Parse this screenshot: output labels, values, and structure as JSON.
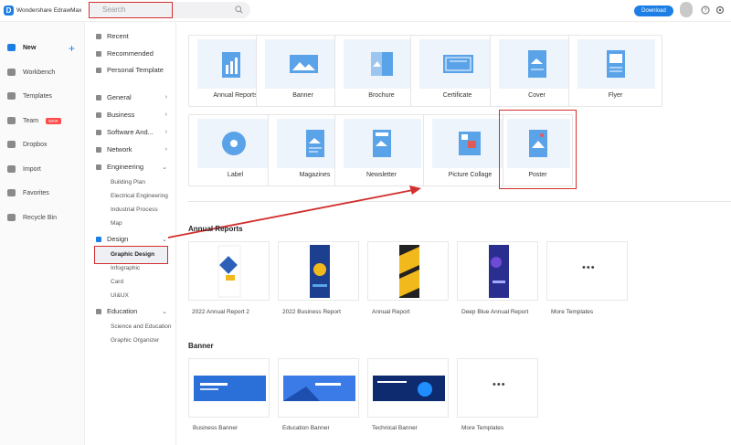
{
  "app": {
    "name": "Wondershare EdrawMax"
  },
  "search": {
    "placeholder": "Search"
  },
  "header": {
    "download_label": "Download"
  },
  "nav": {
    "items": [
      {
        "label": "New",
        "active": true
      },
      {
        "label": "Workbench"
      },
      {
        "label": "Templates"
      },
      {
        "label": "Team",
        "badge": "NEW"
      },
      {
        "label": "Dropbox"
      },
      {
        "label": "Import"
      },
      {
        "label": "Favorites"
      },
      {
        "label": "Recycle Bin"
      }
    ]
  },
  "categories": {
    "top": [
      "Recent",
      "Recommended",
      "Personal Template"
    ],
    "groups": [
      "General",
      "Business",
      "Software And...",
      "Network",
      "Engineering"
    ],
    "engineering_sub": [
      "Building Plan",
      "Electrical Engineering",
      "Industrial Process",
      "Map"
    ],
    "design": "Design",
    "design_sub": [
      "Graphic Design",
      "Infographic",
      "Card",
      "UI&UX"
    ],
    "education": "Education",
    "education_sub": [
      "Science and Education",
      "Graphic Organizer"
    ]
  },
  "template_types": [
    "Annual Reports",
    "Banner",
    "Brochure",
    "Certificate",
    "Cover",
    "Flyer",
    "Label",
    "Magazines",
    "Newsletter",
    "Picture Collage",
    "Poster"
  ],
  "sections": {
    "annual_reports": {
      "title": "Annual Reports",
      "cards": [
        "2022 Annual Report 2",
        "2022 Business Report",
        "Annual Report",
        "Deep Blue Annual Report",
        "More Templates"
      ]
    },
    "banner": {
      "title": "Banner",
      "cards": [
        "Business Banner",
        "Education Banner",
        "Technical Banner",
        "More Templates"
      ]
    }
  },
  "colors": {
    "accent": "#1d7fe5",
    "highlight": "#d32f2f"
  }
}
